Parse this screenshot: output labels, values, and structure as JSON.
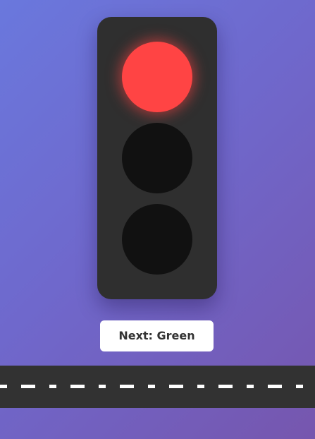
{
  "traffic_light": {
    "active_light": "red",
    "lights": [
      {
        "name": "red",
        "state": "on",
        "color": "#ff4444"
      },
      {
        "name": "yellow",
        "state": "off",
        "color": "#111111"
      },
      {
        "name": "green",
        "state": "off",
        "color": "#111111"
      }
    ],
    "housing_color": "#2f2f2f"
  },
  "controls": {
    "next_label": "Next: Green"
  },
  "road": {
    "color": "#323232",
    "line_color": "#ffffff"
  },
  "background": {
    "gradient_start": "#6a78dd",
    "gradient_end": "#7656ae"
  }
}
